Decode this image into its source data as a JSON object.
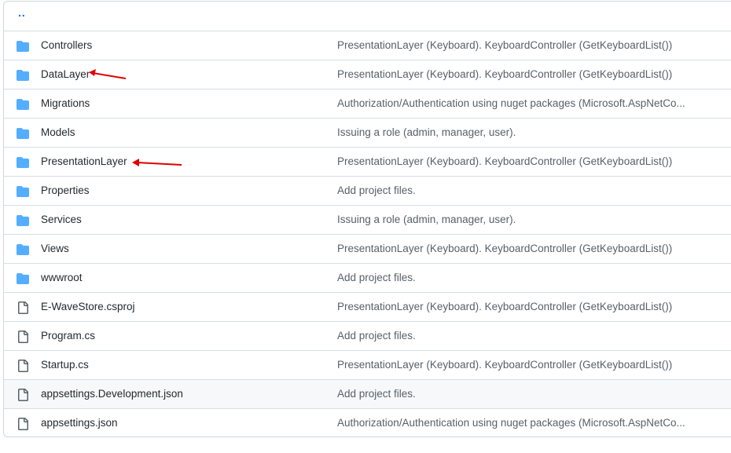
{
  "parent": {
    "label": ".."
  },
  "colors": {
    "folder": "#54aeff",
    "file": "#57606a",
    "link": "#0969da",
    "arrow": "#e00000"
  },
  "rows": [
    {
      "type": "folder",
      "name": "Controllers",
      "message": "PresentationLayer (Keyboard). KeyboardController (GetKeyboardList())"
    },
    {
      "type": "folder",
      "name": "DataLayer",
      "message": "PresentationLayer (Keyboard). KeyboardController (GetKeyboardList())"
    },
    {
      "type": "folder",
      "name": "Migrations",
      "message": "Authorization/Authentication using nuget packages (Microsoft.AspNetCo..."
    },
    {
      "type": "folder",
      "name": "Models",
      "message": "Issuing a role (admin, manager, user)."
    },
    {
      "type": "folder",
      "name": "PresentationLayer",
      "message": "PresentationLayer (Keyboard). KeyboardController (GetKeyboardList())"
    },
    {
      "type": "folder",
      "name": "Properties",
      "message": "Add project files."
    },
    {
      "type": "folder",
      "name": "Services",
      "message": "Issuing a role (admin, manager, user)."
    },
    {
      "type": "folder",
      "name": "Views",
      "message": "PresentationLayer (Keyboard). KeyboardController (GetKeyboardList())"
    },
    {
      "type": "folder",
      "name": "wwwroot",
      "message": "Add project files."
    },
    {
      "type": "file",
      "name": "E-WaveStore.csproj",
      "message": "PresentationLayer (Keyboard). KeyboardController (GetKeyboardList())"
    },
    {
      "type": "file",
      "name": "Program.cs",
      "message": "Add project files."
    },
    {
      "type": "file",
      "name": "Startup.cs",
      "message": "PresentationLayer (Keyboard). KeyboardController (GetKeyboardList())"
    },
    {
      "type": "file",
      "name": "appsettings.Development.json",
      "message": "Add project files."
    },
    {
      "type": "file",
      "name": "appsettings.json",
      "message": "Authorization/Authentication using nuget packages (Microsoft.AspNetCo..."
    }
  ]
}
